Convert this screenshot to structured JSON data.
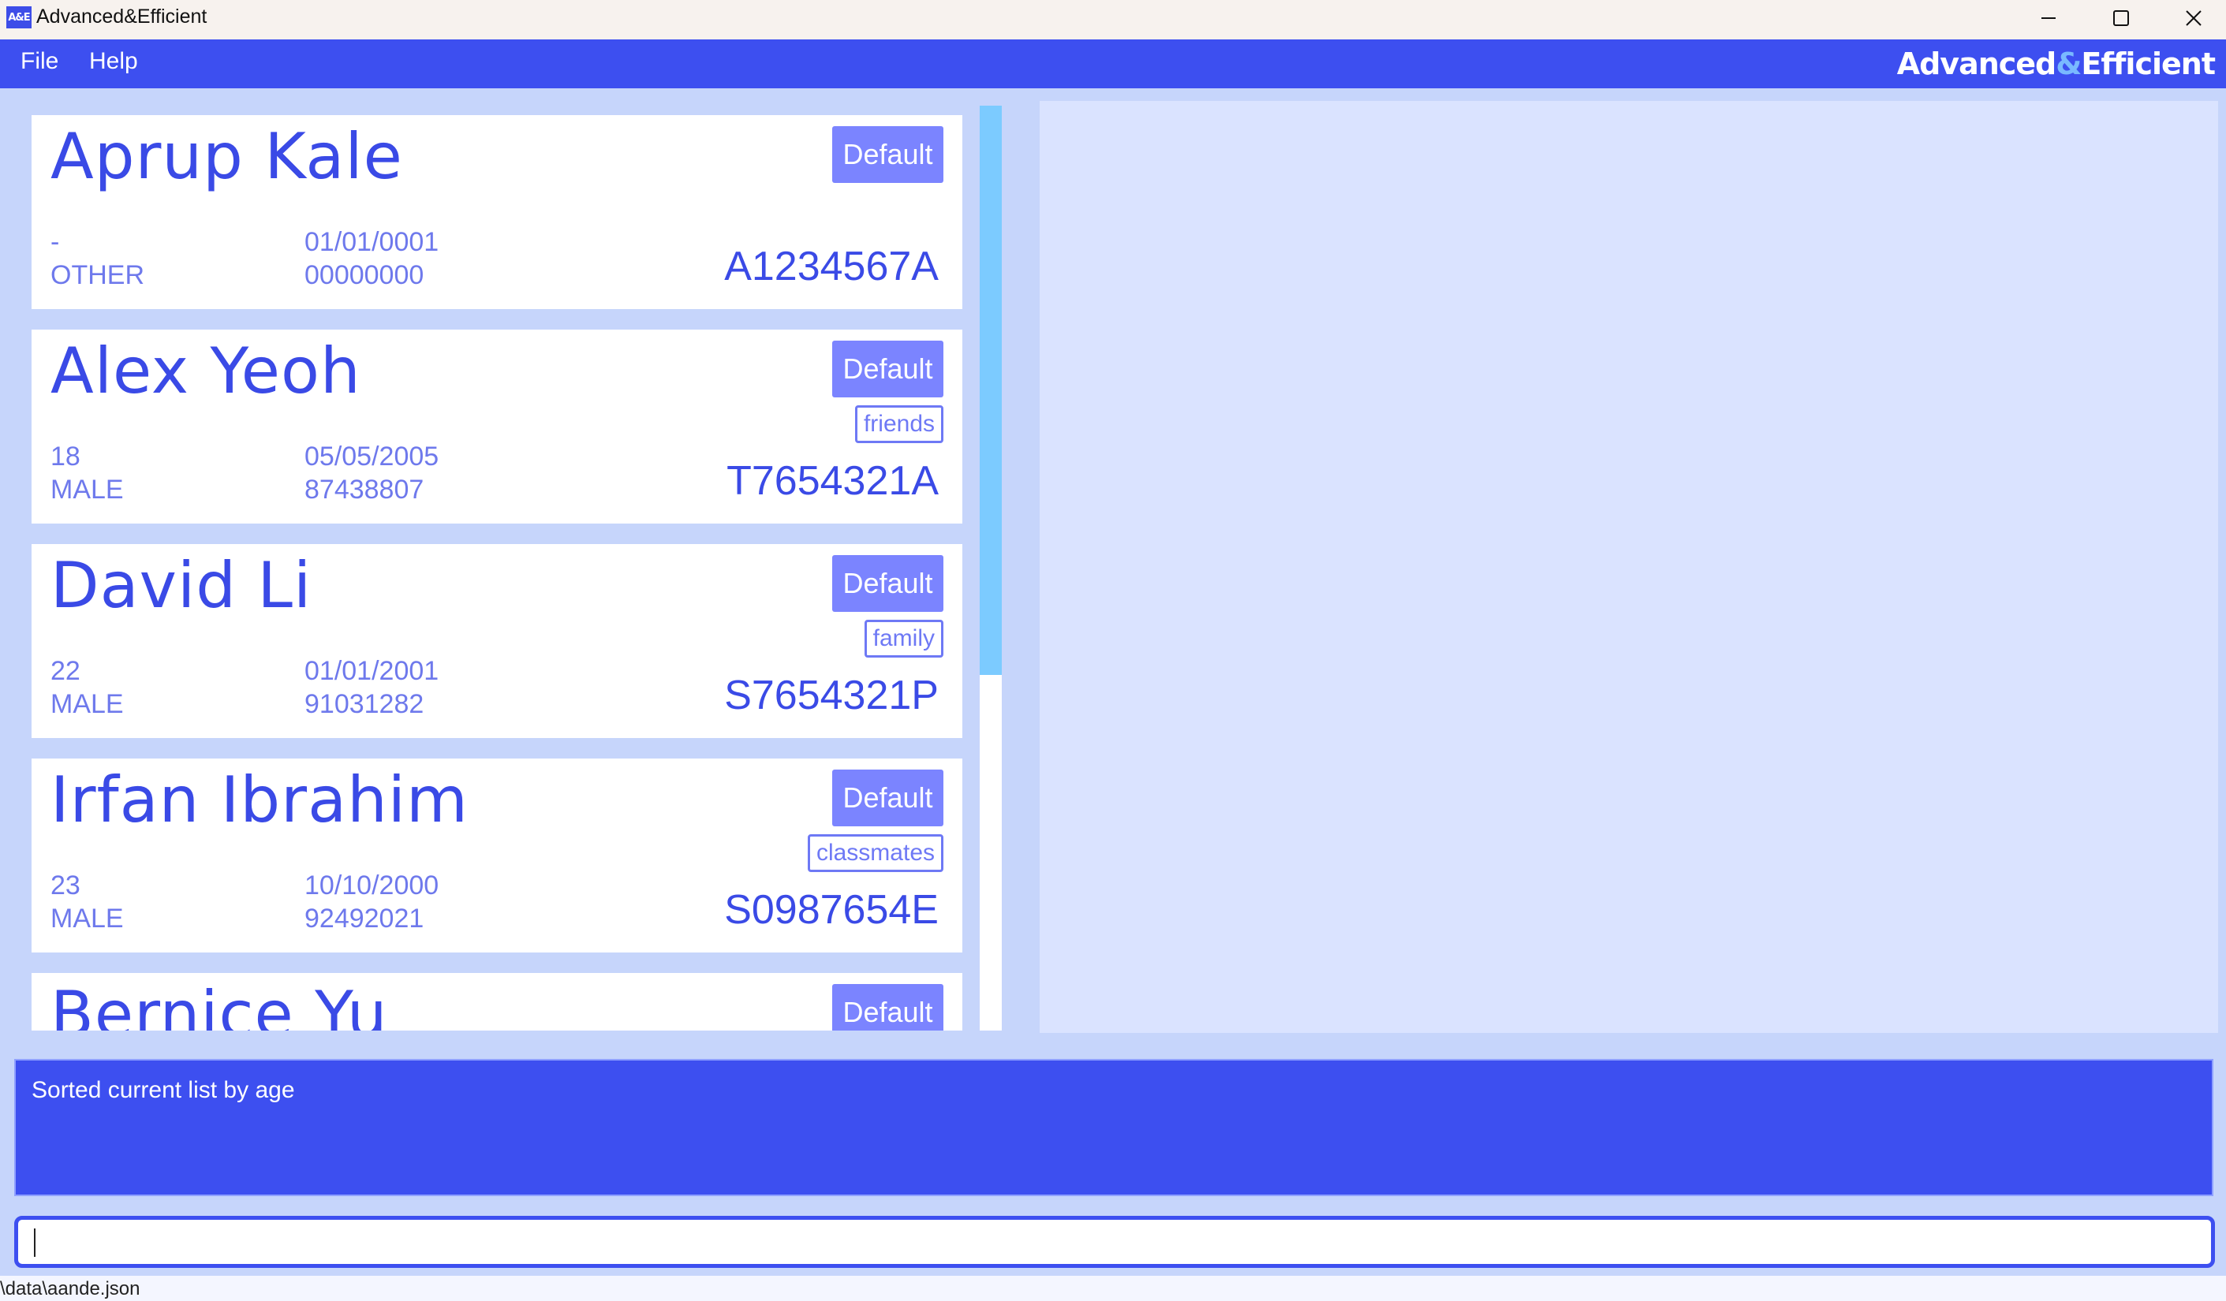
{
  "window": {
    "title": "Advanced&Efficient",
    "icon_text": "A&E"
  },
  "menu": {
    "file": "File",
    "help": "Help"
  },
  "brand": {
    "part1": "Advanced",
    "amp": "&",
    "part2": "Efficient"
  },
  "persons": [
    {
      "name": "Aprup Kale",
      "priority": "Default",
      "tag": "",
      "age": "-",
      "gender": "OTHER",
      "dob": "01/01/0001",
      "phone": "00000000",
      "nric": "A1234567A"
    },
    {
      "name": "Alex Yeoh",
      "priority": "Default",
      "tag": "friends",
      "age": "18",
      "gender": "MALE",
      "dob": "05/05/2005",
      "phone": "87438807",
      "nric": "T7654321A"
    },
    {
      "name": "David Li",
      "priority": "Default",
      "tag": "family",
      "age": "22",
      "gender": "MALE",
      "dob": "01/01/2001",
      "phone": "91031282",
      "nric": "S7654321P"
    },
    {
      "name": "Irfan Ibrahim",
      "priority": "Default",
      "tag": "classmates",
      "age": "23",
      "gender": "MALE",
      "dob": "10/10/2000",
      "phone": "92492021",
      "nric": "S0987654E"
    },
    {
      "name": "Bernice Yu",
      "priority": "Default",
      "tag": "",
      "age": "",
      "gender": "",
      "dob": "",
      "phone": "",
      "nric": ""
    }
  ],
  "result": {
    "message": "Sorted current list by age"
  },
  "command": {
    "value": ""
  },
  "status": {
    "path": "\\data\\aande.json"
  },
  "colors": {
    "primary": "#3d4ff0",
    "accent": "#7b84ff",
    "scroll_thumb": "#7ccbff",
    "detail_bg": "#dae3ff"
  }
}
